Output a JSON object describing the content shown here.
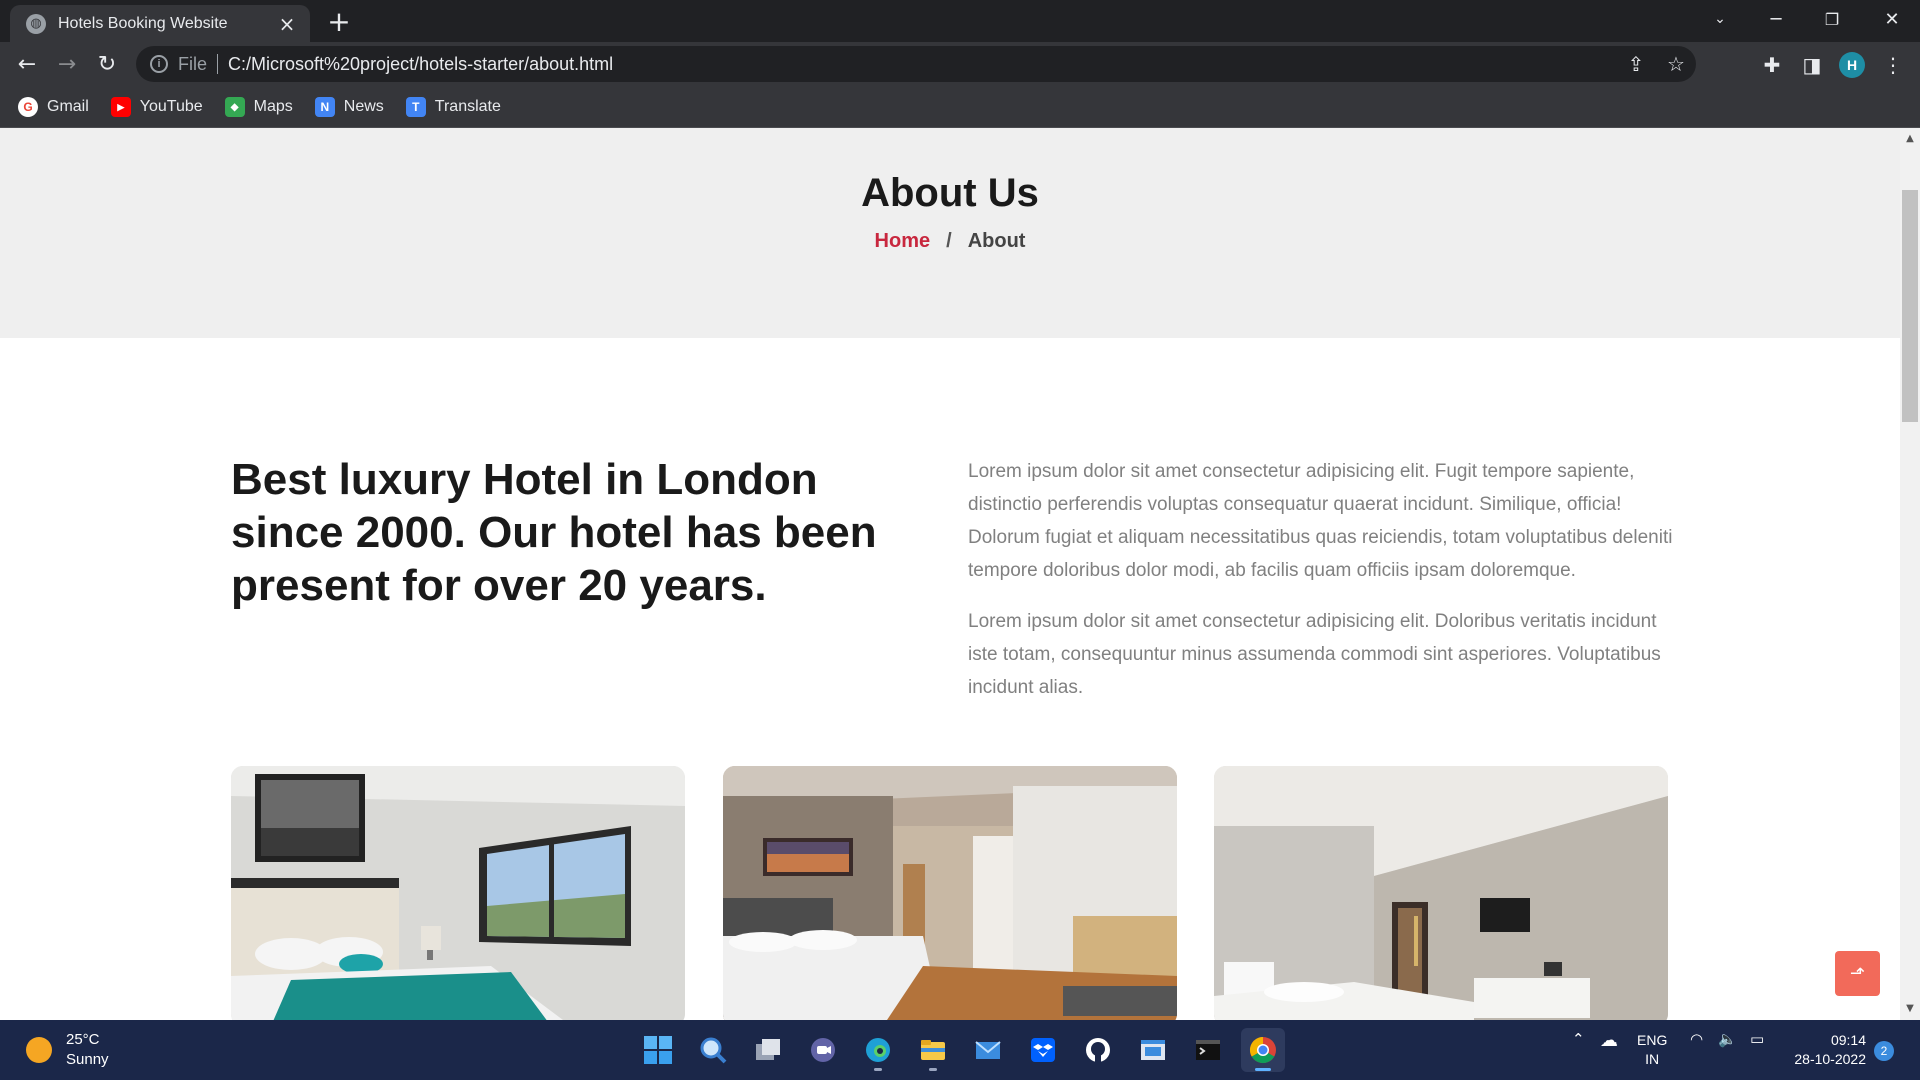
{
  "browser": {
    "tab_title": "Hotels Booking Website",
    "tab_close": "×",
    "new_tab": "+",
    "scheme_label": "File",
    "url": "C:/Microsoft%20project/hotels-starter/about.html",
    "profile_initial": "H",
    "bookmarks": [
      {
        "label": "Gmail",
        "icon": "gmail-icon",
        "color": "#ea4335",
        "glyph": "G"
      },
      {
        "label": "YouTube",
        "icon": "youtube-icon",
        "color": "#ff0000",
        "glyph": "▶"
      },
      {
        "label": "Maps",
        "icon": "maps-icon",
        "color": "#34a853",
        "glyph": "◆"
      },
      {
        "label": "News",
        "icon": "news-icon",
        "color": "#4285f4",
        "glyph": "N"
      },
      {
        "label": "Translate",
        "icon": "translate-icon",
        "color": "#4285f4",
        "glyph": "T"
      }
    ]
  },
  "page": {
    "title": "About Us",
    "breadcrumb": {
      "home": "Home",
      "separator": "/",
      "current": "About"
    },
    "about": {
      "heading": "Best luxury Hotel in London since 2000. Our hotel has been present for over 20 years.",
      "paragraph_1": "Lorem ipsum dolor sit amet consectetur adipisicing elit. Fugit tempore sapiente, distinctio perferendis voluptas consequatur quaerat incidunt. Similique, officia! Dolorum fugiat et aliquam necessitatibus quas reiciendis, totam voluptatibus deleniti tempore doloribus dolor modi, ab facilis quam officiis ipsam doloremque.",
      "paragraph_2": "Lorem ipsum dolor sit amet consectetur adipisicing elit. Doloribus veritatis incidunt iste totam, consequuntur minus assumenda commodi sint asperiores. Voluptatibus incidunt alias."
    },
    "rooms": [
      "room-photo-1",
      "room-photo-2",
      "room-photo-3"
    ],
    "accent_color": "#c8273e",
    "back_to_top_color": "#f26a5a"
  },
  "taskbar": {
    "temperature": "25°C",
    "condition": "Sunny",
    "lang_line1": "ENG",
    "lang_line2": "IN",
    "time": "09:14",
    "date": "28-10-2022",
    "notifications": "2"
  }
}
